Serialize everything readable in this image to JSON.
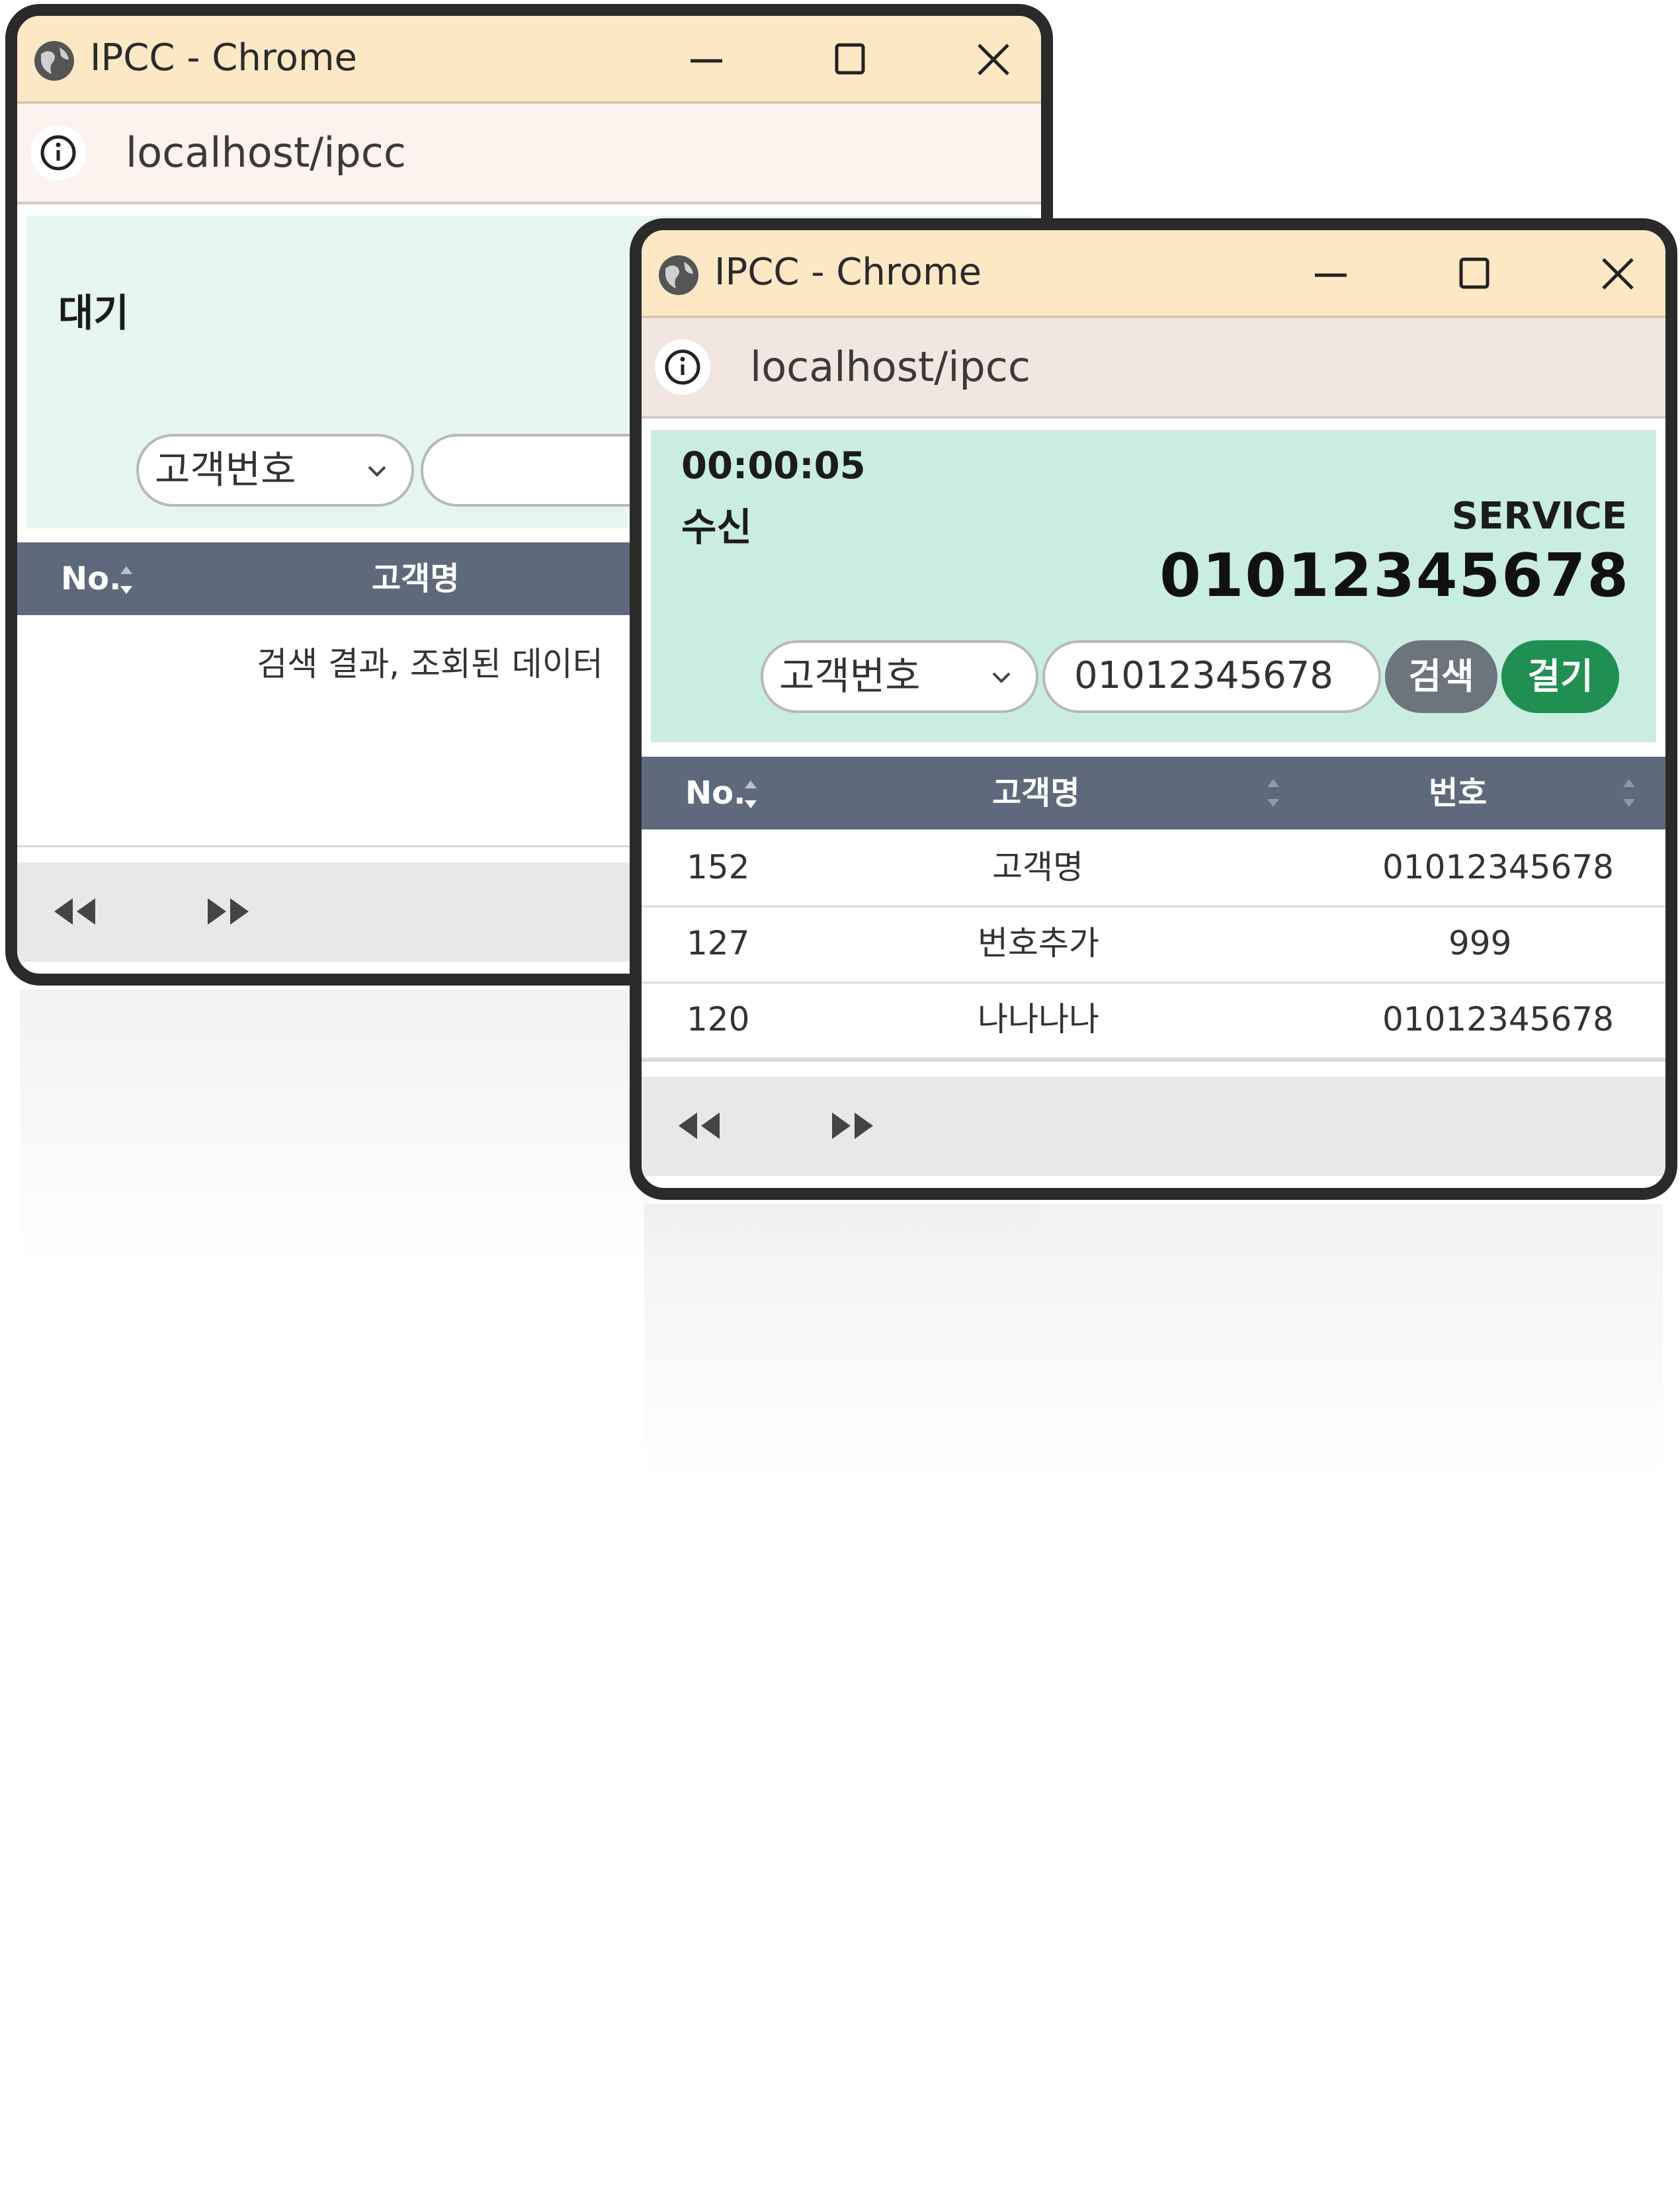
{
  "back_window": {
    "title": "IPCC - Chrome",
    "url": "localhost/ipcc",
    "status": "대기",
    "search": {
      "selected": "고객번호",
      "value": ""
    },
    "table": {
      "headers": [
        "No.",
        "고객명"
      ],
      "empty_message": "검색 결과, 조회된 데이터"
    }
  },
  "front_window": {
    "title": "IPCC - Chrome",
    "url": "localhost/ipcc",
    "timer": "00:00:05",
    "status": "수신",
    "service_label": "SERVICE",
    "phone_number": "01012345678",
    "search": {
      "selected": "고객번호",
      "value": "01012345678",
      "search_button": "검색",
      "call_button": "걸기"
    },
    "table": {
      "headers": [
        "No.",
        "고객명",
        "번호"
      ],
      "rows": [
        {
          "no": "152",
          "name": "고객명",
          "number": "01012345678"
        },
        {
          "no": "127",
          "name": "번호추가",
          "number": "999"
        },
        {
          "no": "120",
          "name": "나나나나",
          "number": "01012345678"
        }
      ]
    }
  },
  "icons": [
    "globe-icon",
    "minimize-icon",
    "maximize-icon",
    "close-icon",
    "info-icon",
    "chevron-down-icon",
    "sort-icon",
    "first-page-icon",
    "last-page-icon"
  ],
  "colors": {
    "titlebar": "#fde8c6",
    "panel": "#c9ede0",
    "table_header": "#5e6a7c",
    "search_button": "#6c757d",
    "call_button": "#218f52"
  }
}
